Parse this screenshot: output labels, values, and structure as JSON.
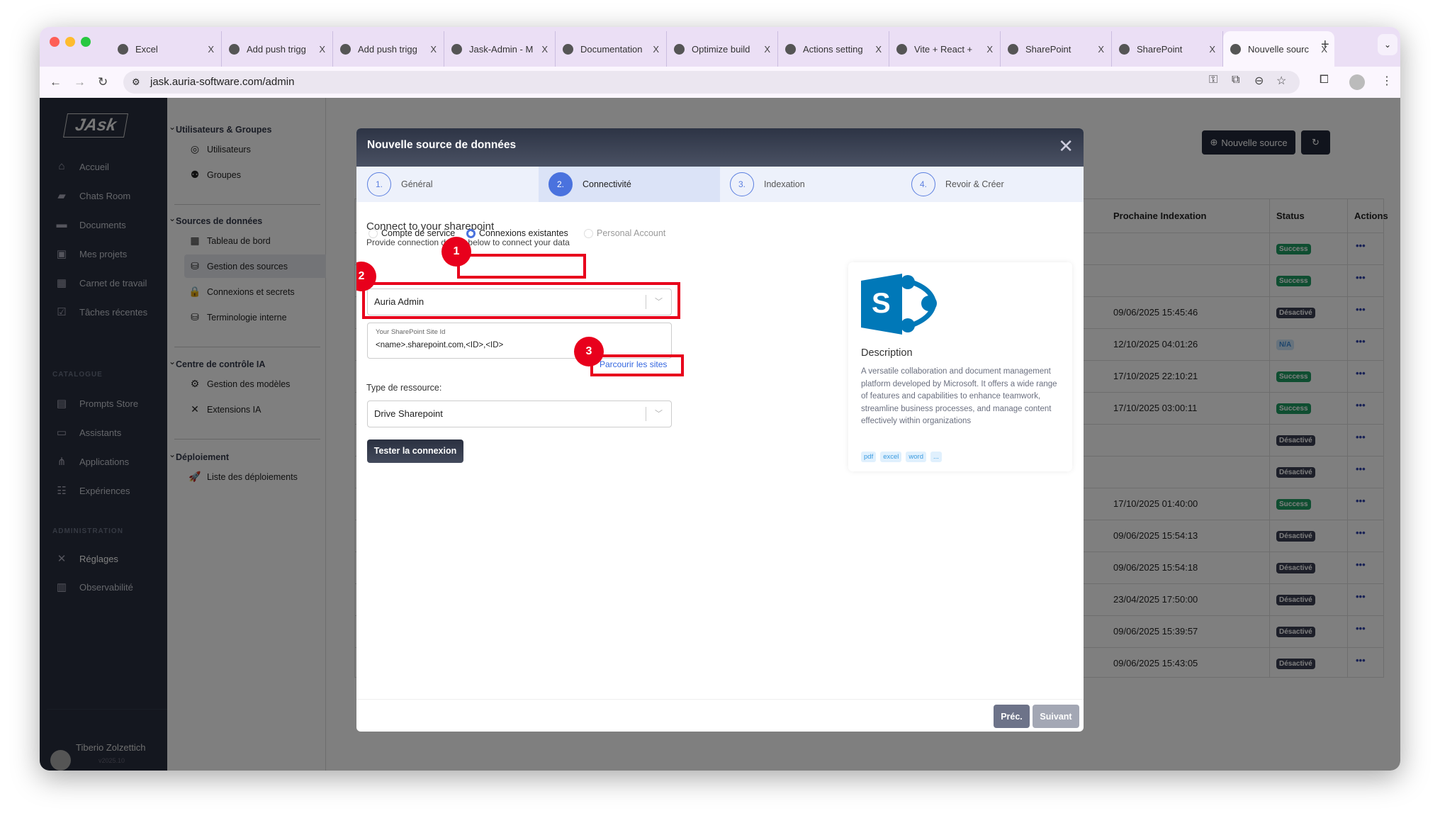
{
  "browser": {
    "tabs": [
      {
        "title": "Excel",
        "icon": "globe-icon"
      },
      {
        "title": "Add push trigg",
        "icon": "github-error-icon"
      },
      {
        "title": "Add push trigg",
        "icon": "github-error-icon"
      },
      {
        "title": "Jask-Admin - M",
        "icon": "azure-icon"
      },
      {
        "title": "Documentation",
        "icon": "globe-icon"
      },
      {
        "title": "Optimize build",
        "icon": "openai-icon"
      },
      {
        "title": "Actions setting",
        "icon": "github-icon"
      },
      {
        "title": "Vite + React +",
        "icon": "vite-icon"
      },
      {
        "title": "SharePoint",
        "icon": "globe-icon"
      },
      {
        "title": "SharePoint",
        "icon": "globe-icon"
      },
      {
        "title": "Nouvelle sourc",
        "icon": "jask-icon",
        "active": true
      }
    ],
    "close_glyph": "X",
    "new_tab": "+",
    "url": "jask.auria-software.com/admin"
  },
  "sidebar": {
    "logo": "JAsk",
    "items": [
      {
        "label": "Accueil",
        "icon": "home-icon"
      },
      {
        "label": "Chats Room",
        "icon": "chat-icon"
      },
      {
        "label": "Documents",
        "icon": "folder-icon"
      },
      {
        "label": "Mes projets",
        "icon": "briefcase-icon"
      },
      {
        "label": "Carnet de travail",
        "icon": "grid-icon"
      },
      {
        "label": "Tâches récentes",
        "icon": "task-icon"
      }
    ],
    "catalogue_title": "CATALOGUE",
    "catalogue": [
      {
        "label": "Prompts Store",
        "icon": "message-icon"
      },
      {
        "label": "Assistants",
        "icon": "monitor-icon"
      },
      {
        "label": "Applications",
        "icon": "hierarchy-icon"
      },
      {
        "label": "Expériences",
        "icon": "tree-icon"
      }
    ],
    "admin_title": "ADMINISTRATION",
    "admin": [
      {
        "label": "Réglages",
        "icon": "tools-icon"
      },
      {
        "label": "Observabilité",
        "icon": "bar-chart-icon"
      }
    ],
    "user": {
      "name": "Tiberio Zolzettich",
      "version": "v2025.10"
    }
  },
  "subnav": {
    "groups": [
      {
        "title": "Utilisateurs & Groupes",
        "items": [
          {
            "label": "Utilisateurs"
          },
          {
            "label": "Groupes"
          }
        ]
      },
      {
        "title": "Sources de données",
        "items": [
          {
            "label": "Tableau de bord"
          },
          {
            "label": "Gestion des sources",
            "active": true
          },
          {
            "label": "Connexions et secrets"
          },
          {
            "label": "Terminologie interne"
          }
        ]
      },
      {
        "title": "Centre de contrôle IA",
        "items": [
          {
            "label": "Gestion des modèles"
          },
          {
            "label": "Extensions IA"
          }
        ]
      },
      {
        "title": "Déploiement",
        "items": [
          {
            "label": "Liste des déploiements"
          }
        ]
      }
    ]
  },
  "main": {
    "new_source_label": "Nouvelle source",
    "refresh_glyph": "↻",
    "columns": [
      "Prochaine Indexation",
      "Status",
      "Actions"
    ],
    "rows": [
      {
        "next": "",
        "status": "Success"
      },
      {
        "next": "",
        "status": "Success"
      },
      {
        "next": "09/06/2025 15:45:46",
        "status": "Désactivé"
      },
      {
        "next": "12/10/2025 04:01:26",
        "status": "N/A"
      },
      {
        "next": "17/10/2025 22:10:21",
        "status": "Success"
      },
      {
        "next": "17/10/2025 03:00:11",
        "status": "Success"
      },
      {
        "next": "",
        "status": "Désactivé"
      },
      {
        "next": "",
        "status": "Désactivé"
      },
      {
        "next": "17/10/2025 01:40:00",
        "status": "Success"
      },
      {
        "next": "09/06/2025 15:54:13",
        "status": "Désactivé"
      },
      {
        "next": "09/06/2025 15:54:18",
        "status": "Désactivé"
      },
      {
        "next": "23/04/2025 17:50:00",
        "status": "Désactivé"
      },
      {
        "next": "09/06/2025 15:39:57",
        "status": "Désactivé"
      },
      {
        "next": "09/06/2025 15:43:05",
        "status": "Désactivé"
      }
    ],
    "actions_glyph": "•••",
    "status_colors": {
      "Success": "#1f9d63",
      "Désactivé": "#3b3f52",
      "N/A": "#cfe6fb"
    }
  },
  "modal": {
    "title": "Nouvelle source de données",
    "close_glyph": "✕",
    "steps": [
      {
        "num": "1.",
        "label": "Général"
      },
      {
        "num": "2.",
        "label": "Connectivité",
        "active": true
      },
      {
        "num": "3.",
        "label": "Indexation"
      },
      {
        "num": "4.",
        "label": "Revoir & Créer"
      }
    ],
    "heading": "Connect to your sharepoint",
    "subheading": "Provide connection details below to connect your data",
    "auth_options": [
      {
        "label": "Compte de service",
        "selected": false
      },
      {
        "label": "Connexions existantes",
        "selected": true
      },
      {
        "label": "Personal Account",
        "selected": false
      }
    ],
    "connection_select": "Auria Admin",
    "site_id_label": "Your SharePoint Site Id",
    "site_id_value": "<name>.sharepoint.com,<ID>,<ID>",
    "browse_link": "Parcourir les sites",
    "resource_type_label": "Type de ressource:",
    "resource_type_value": "Drive Sharepoint",
    "test_button": "Tester la connexion",
    "card": {
      "title": "Description",
      "text": "A versatile collaboration and document management platform developed by Microsoft. It offers a wide range of features and capabilities to enhance teamwork, streamline business processes, and manage content effectively within organizations",
      "tags": [
        "pdf",
        "excel",
        "word",
        "..."
      ],
      "brand_color": "#0078b8"
    },
    "prev_button": "Préc.",
    "next_button": "Suivant"
  },
  "annotations": {
    "markers": [
      "1",
      "2",
      "3"
    ],
    "color": "#e8001c"
  }
}
